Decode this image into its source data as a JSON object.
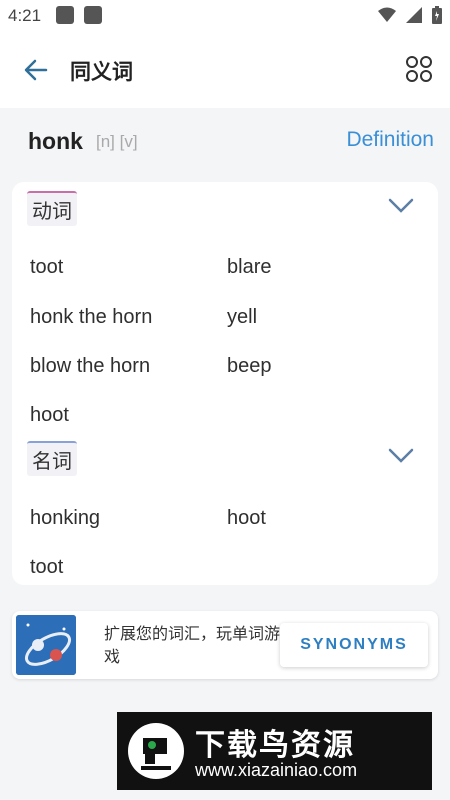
{
  "status_bar": {
    "time": "4:21"
  },
  "app_bar": {
    "title": "同义词"
  },
  "word_header": {
    "word": "honk",
    "pos_tags": "[n] [v]",
    "definition_link": "Definition"
  },
  "sections": [
    {
      "label": "动词",
      "synonyms": [
        "toot",
        "blare",
        "honk the horn",
        "yell",
        "blow the horn",
        "beep",
        "hoot"
      ]
    },
    {
      "label": "名词",
      "synonyms": [
        "honking",
        "hoot",
        "toot"
      ]
    }
  ],
  "promo": {
    "text": "扩展您的词汇，玩单词游戏",
    "button_label": "SYNONYMS"
  },
  "watermark": {
    "title": "下载鸟资源",
    "url": "www.xiazainiao.com"
  }
}
